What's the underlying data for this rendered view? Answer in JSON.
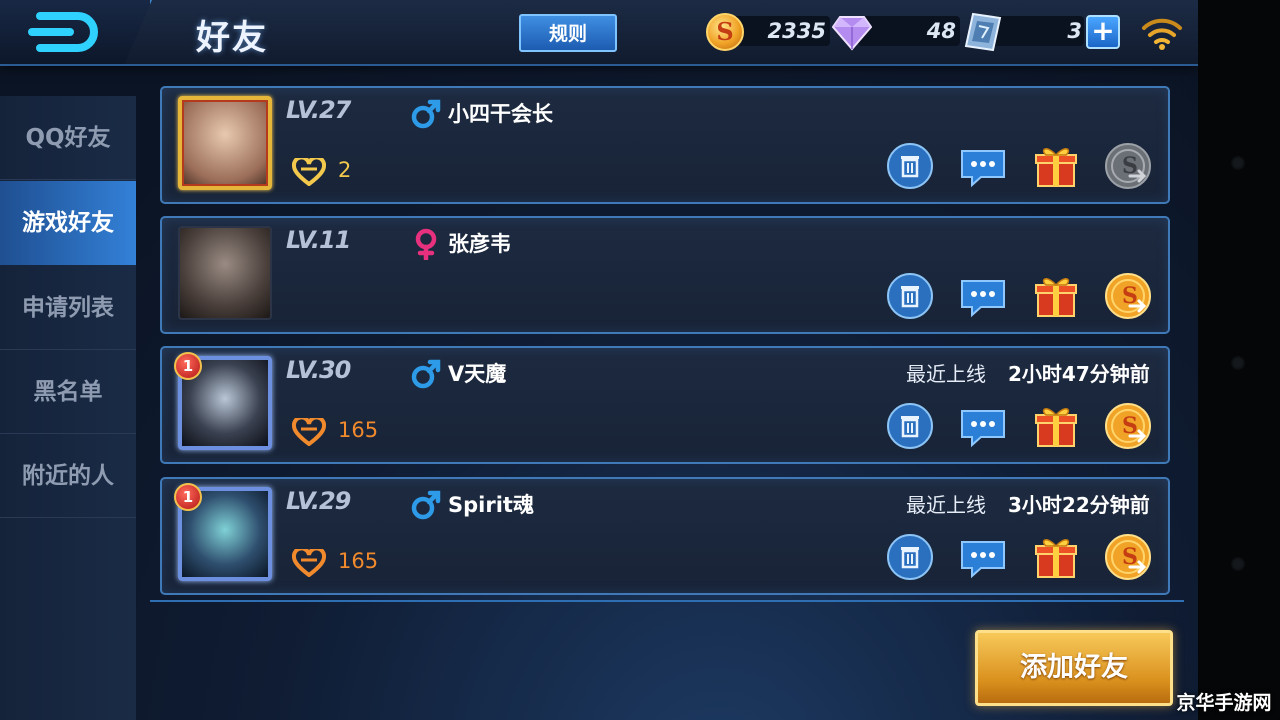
{
  "header": {
    "title": "好友",
    "rules_label": "规则",
    "gold": "2335",
    "diamonds": "48",
    "vouchers": "3",
    "coin_symbol": "S",
    "plus_symbol": "+",
    "back_icon": "back-arrow-icon",
    "signal_icon": "wifi-signal-icon"
  },
  "sidebar": {
    "items": [
      {
        "label": "QQ好友",
        "active": false
      },
      {
        "label": "游戏好友",
        "active": true
      },
      {
        "label": "申请列表",
        "active": false
      },
      {
        "label": "黑名单",
        "active": false
      },
      {
        "label": "附近的人",
        "active": false
      }
    ]
  },
  "friends": [
    {
      "level": "LV.27",
      "gender": "male",
      "name": "小四干会长",
      "intimacy": "2",
      "intimacy_color": "#f2c94c",
      "rank_badge": "",
      "last_online_label": "",
      "last_online_time": ""
    },
    {
      "level": "LV.11",
      "gender": "female",
      "name": "张彦韦",
      "intimacy": "",
      "intimacy_color": "",
      "rank_badge": "",
      "last_online_label": "",
      "last_online_time": ""
    },
    {
      "level": "LV.30",
      "gender": "male",
      "name": "V天魔",
      "intimacy": "165",
      "intimacy_color": "#f08a2c",
      "rank_badge": "1",
      "last_online_label": "最近上线",
      "last_online_time": "2小时47分钟前"
    },
    {
      "level": "LV.29",
      "gender": "male",
      "name": "Spirit魂",
      "intimacy": "165",
      "intimacy_color": "#f08a2c",
      "rank_badge": "1",
      "last_online_label": "最近上线",
      "last_online_time": "3小时22分钟前"
    }
  ],
  "colors": {
    "male": "#2d9be8",
    "female": "#e8317e",
    "accent_blue": "#3381d8",
    "gold": "#f0a327"
  },
  "footer": {
    "add_friend_label": "添加好友",
    "watermark": "京华手游网"
  }
}
